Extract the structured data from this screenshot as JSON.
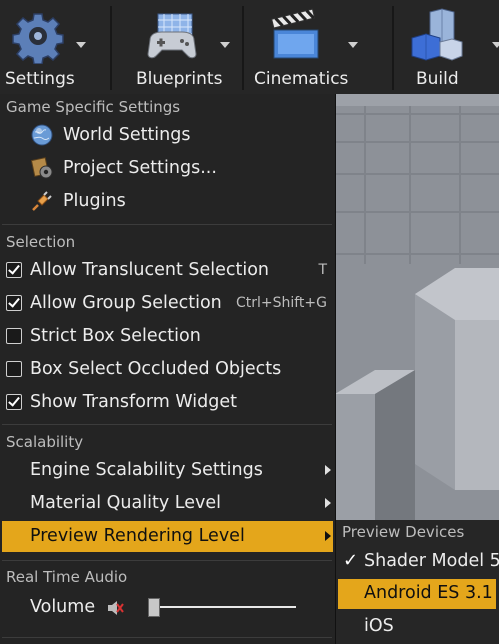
{
  "toolbar": {
    "settings": "Settings",
    "blueprints": "Blueprints",
    "cinematics": "Cinematics",
    "build": "Build"
  },
  "menu": {
    "game_section": "Game Specific Settings",
    "world_settings": "World Settings",
    "project_settings": "Project Settings...",
    "plugins": "Plugins",
    "selection_section": "Selection",
    "allow_translucent": {
      "label": "Allow Translucent Selection",
      "shortcut": "T",
      "checked": true
    },
    "allow_group": {
      "label": "Allow Group Selection",
      "shortcut": "Ctrl+Shift+G",
      "checked": true
    },
    "strict_box": {
      "label": "Strict Box Selection",
      "checked": false
    },
    "box_occluded": {
      "label": "Box Select Occluded Objects",
      "checked": false
    },
    "show_transform": {
      "label": "Show Transform Widget",
      "checked": true
    },
    "scalability_section": "Scalability",
    "engine_scalability": "Engine Scalability Settings",
    "material_quality": "Material Quality Level",
    "preview_rendering": "Preview Rendering Level",
    "audio_section": "Real Time Audio",
    "volume_label": "Volume",
    "volume_level": 0.0
  },
  "submenu": {
    "section": "Preview Devices",
    "items": [
      {
        "label": "Shader Model 5",
        "checked": true
      },
      {
        "label": "Android ES 3.1",
        "highlighted": true
      },
      {
        "label": "iOS"
      }
    ]
  },
  "colors": {
    "highlight": "#e4a61b",
    "menu_bg": "#242424"
  }
}
